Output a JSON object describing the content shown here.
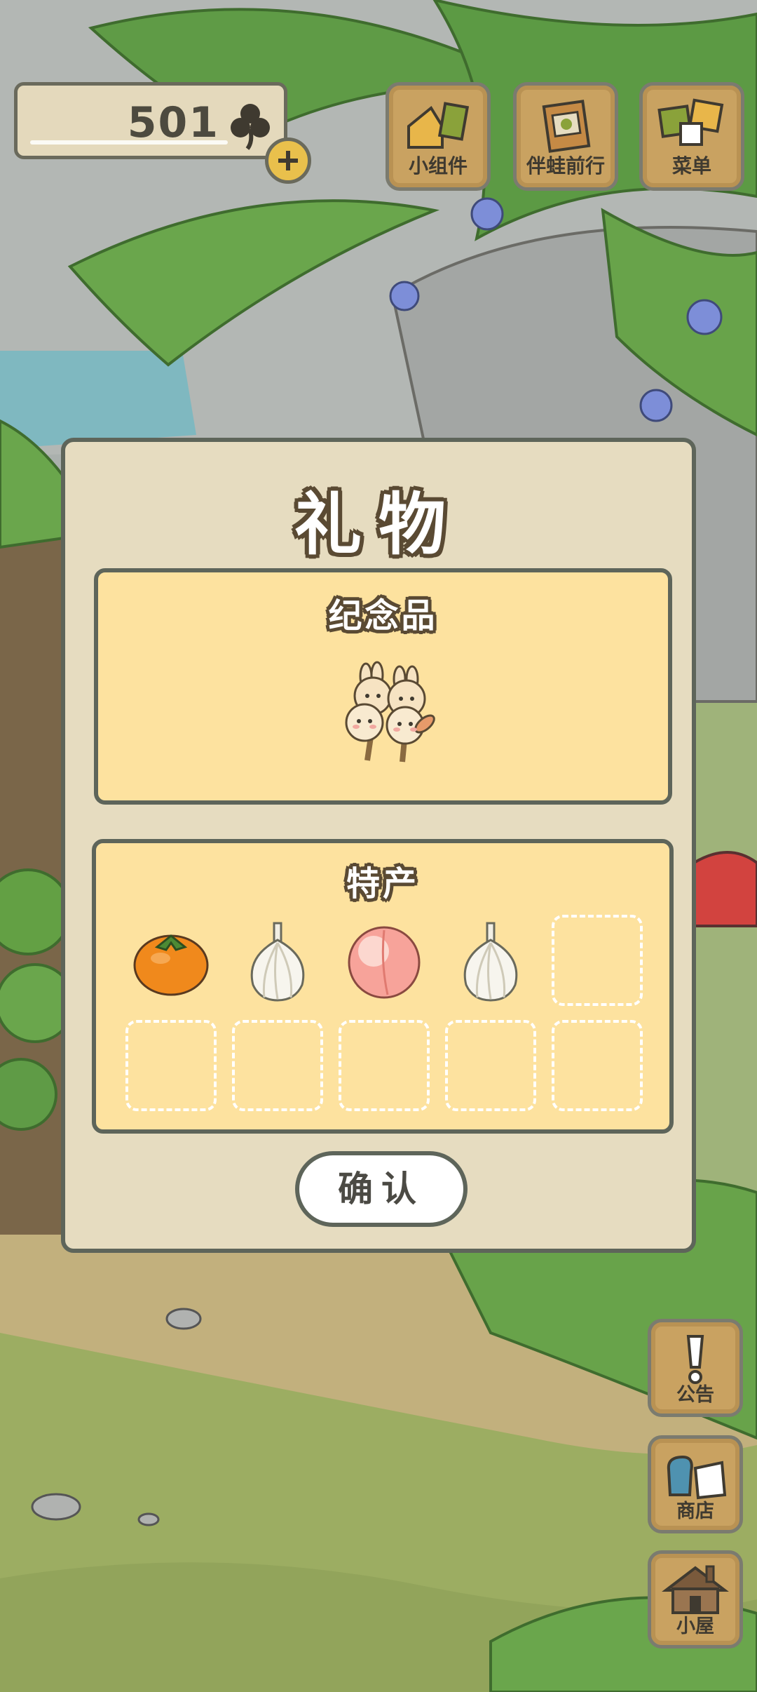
{
  "header": {
    "clover_count": "501",
    "clover_icon": "clover-icon",
    "add_icon": "plus-icon"
  },
  "top_buttons": [
    {
      "label": "小组件",
      "icon": "widget-icon"
    },
    {
      "label": "伴蛙前行",
      "icon": "album-icon"
    },
    {
      "label": "菜单",
      "icon": "menu-cards-icon"
    }
  ],
  "side_buttons": [
    {
      "label": "公告",
      "icon": "exclamation-icon"
    },
    {
      "label": "商店",
      "icon": "shop-bag-icon"
    },
    {
      "label": "小屋",
      "icon": "house-icon"
    }
  ],
  "dialog": {
    "title": "礼物",
    "souvenir": {
      "title": "纪念品",
      "item": "bunny-dango-icon"
    },
    "specialty": {
      "title": "特产",
      "items": [
        "persimmon-icon",
        "garlic-icon",
        "peach-icon",
        "garlic-icon"
      ],
      "empty_slots": 6
    },
    "confirm_label": "确认"
  },
  "colors": {
    "panel_fill": "#fde29f",
    "dialog_fill": "#e6dcc0",
    "border": "#5e655a",
    "button_wood": "#c9a261"
  }
}
